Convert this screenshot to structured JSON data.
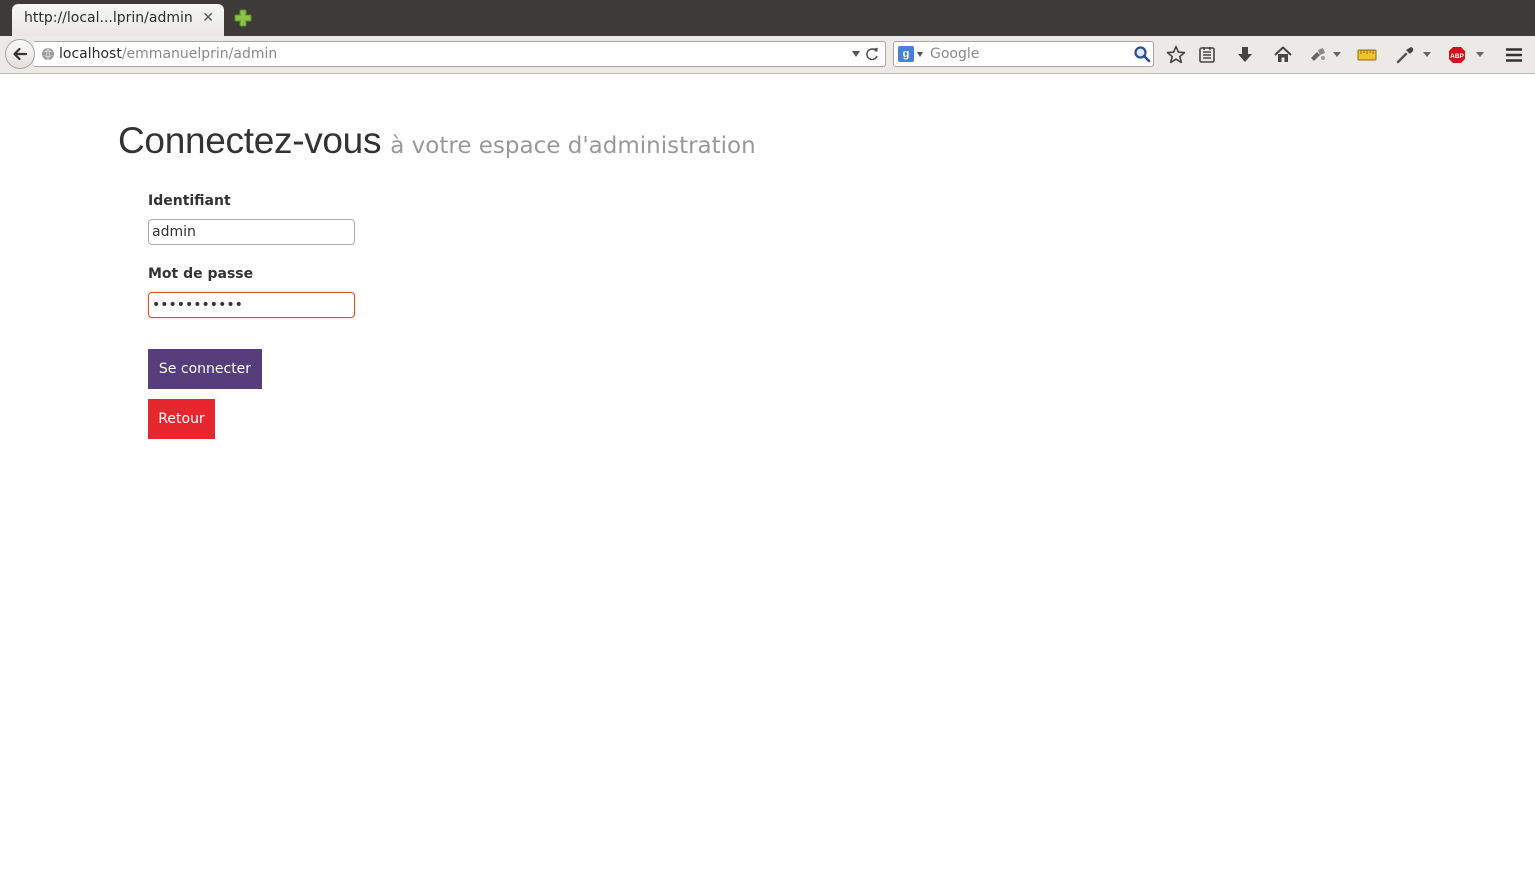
{
  "browser": {
    "tab": {
      "title": "http://local...lprin/admin",
      "close_glyph": "✕",
      "close_icon": "close-icon"
    },
    "new_tab_icon": "plus-icon",
    "urlbar": {
      "host": "localhost",
      "path": "/emmanuelprin/admin"
    },
    "searchbar": {
      "engine_letter": "g",
      "placeholder": "Google"
    },
    "toolbar_icons": [
      "bookmark-star-icon",
      "reading-list-icon",
      "download-icon",
      "home-icon",
      "extension-icon",
      "ruler-icon",
      "eyedropper-icon",
      "adblock-plus-icon",
      "menu-icon"
    ],
    "adblock_label": "ABP"
  },
  "login": {
    "heading": "Connectez-vous",
    "subheading": "à votre espace d'administration",
    "username_label": "Identifiant",
    "username_value": "admin",
    "password_label": "Mot de passe",
    "password_value": "•••••••••••",
    "submit_label": "Se connecter",
    "back_label": "Retour"
  },
  "colors": {
    "submit_button": "#563d7c",
    "back_button": "#e7262e",
    "focus_border": "#e2542b"
  }
}
